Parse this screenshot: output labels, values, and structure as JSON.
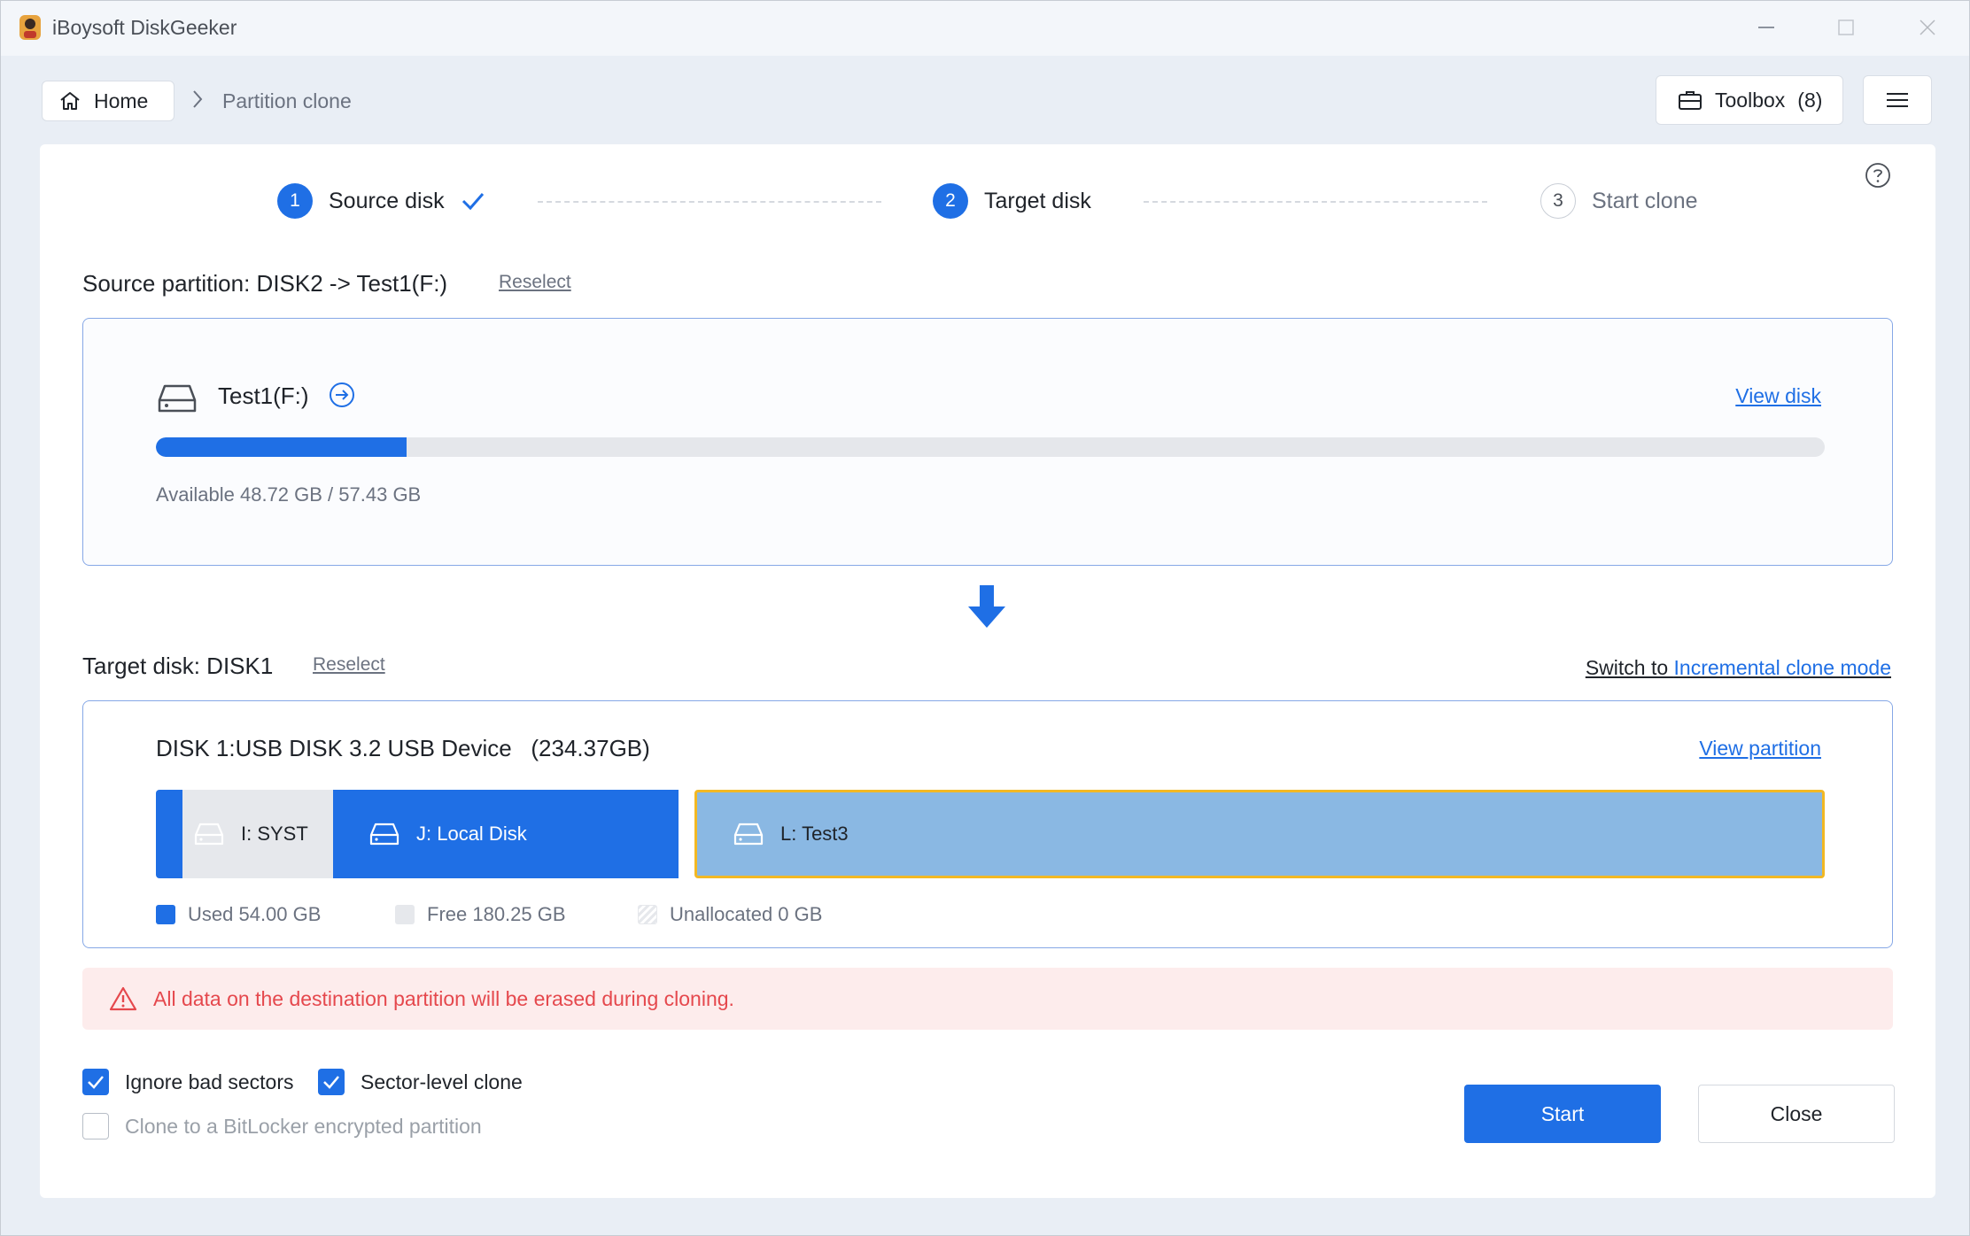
{
  "window": {
    "title": "iBoysoft DiskGeeker"
  },
  "breadcrumb": {
    "home_label": "Home",
    "current": "Partition clone"
  },
  "toolbar": {
    "toolbox_label": "Toolbox",
    "toolbox_count": "(8)"
  },
  "steps": [
    {
      "number": "1",
      "label": "Source disk",
      "state": "done"
    },
    {
      "number": "2",
      "label": "Target disk",
      "state": "active"
    },
    {
      "number": "3",
      "label": "Start clone",
      "state": "todo"
    }
  ],
  "source": {
    "heading": "Source partition: DISK2 -> Test1(F:)",
    "reselect_label": "Reselect",
    "partition_name": "Test1(F:)",
    "view_disk_label": "View disk",
    "used_fraction": 0.15,
    "available_text": "Available 48.72 GB / 57.43 GB"
  },
  "target": {
    "heading": "Target disk: DISK1",
    "reselect_label": "Reselect",
    "switch_prefix": "Switch to ",
    "switch_link": "Incremental clone mode",
    "disk_name": "DISK 1:USB DISK 3.2 USB Device",
    "disk_size": "(234.37GB)",
    "view_partition_label": "View partition",
    "partitions": [
      {
        "label": "I: SYST"
      },
      {
        "label": "J: Local Disk"
      },
      {
        "label": "L: Test3"
      }
    ],
    "legend": {
      "used": "Used 54.00 GB",
      "free": "Free 180.25 GB",
      "unallocated": "Unallocated 0 GB"
    }
  },
  "warning": {
    "text": "All data on the destination partition will be erased during cloning."
  },
  "options": {
    "ignore_bad_sectors": {
      "label": "Ignore bad sectors",
      "checked": true
    },
    "sector_level_clone": {
      "label": "Sector-level clone",
      "checked": true
    },
    "bitlocker": {
      "label": "Clone to a BitLocker encrypted partition",
      "checked": false
    }
  },
  "actions": {
    "start_label": "Start",
    "close_label": "Close"
  },
  "colors": {
    "accent": "#1f6fe5",
    "selected_border": "#f2b824",
    "warning_text": "#e5484d"
  }
}
